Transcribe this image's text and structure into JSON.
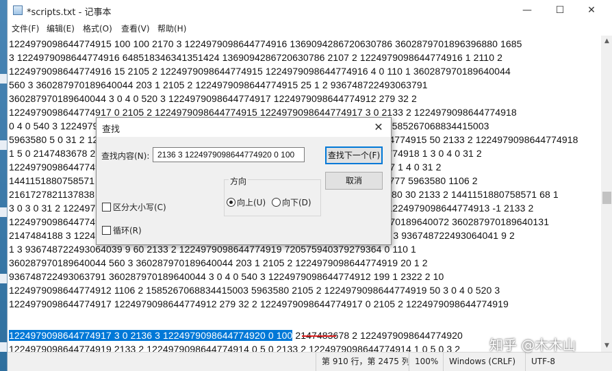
{
  "window": {
    "title": "*scripts.txt - 记事本",
    "minimize_glyph": "—",
    "maximize_glyph": "☐",
    "close_glyph": "✕"
  },
  "menu": [
    {
      "label": "文件(F)"
    },
    {
      "label": "编辑(E)"
    },
    {
      "label": "格式(O)"
    },
    {
      "label": "查看(V)"
    },
    {
      "label": "帮助(H)"
    }
  ],
  "content_lines": [
    "1224979098644774915 100 100 2170 3 1224979098644774916 1369094286720630786 3602879701896396880 1685",
    "3 1224979098644774916 648518346341351424 1369094286720630786 2107 2 1224979098644774916 1 2110 2",
    "1224979098644774916 15 2105 2 1224979098644774915 1224979098644774916 4 0 110 1 360287970189640044",
    "560 3 360287970189640044 203 1 2105 2 1224979098644774915 25 1 2 936748722493063791",
    "360287970189640044 3 0 4 0 520 3 1224979098644774917 1224979098644774912 279 32 2",
    "1224979098644774917 0 2105 2 1224979098644774915 1224979098644774917 3 0 2133 2 1224979098644774918",
    "0 4 0 540 3 1224979098644774917 3 0 2136 3 1224979098644774920 0 100 2 1106 2 1585267068834415003",
    "5963580 5 0 31 2 1224979098644774912 1106 2 1585267068834415003 224979098644774915 50 2133 2 1224979098644774918",
    "1 5 0 2147483678 2 1224979098644774920 2 1224979098644774912 1224979098644774918 1 3 0 4 0 31 2",
    "1224979098644774916 0 5 0 2133 2 1224979098644774914 1224979098644775857167 1 4 0 31 2",
    "1441151880758571 50 5 0 2136 3 1224979098644774920 0 100 2147483678 2 213785777 5963580 1106 2",
    "2161727821137838 2 1224979098644774915 1224979098644774916 3602879701899680 30 2133 2 1441151880758571 68 1",
    "3 0 3 0 31 2 1224979098644774917 1224979098644774912 1224979098644774931 2 1224979098644774913 -1 2133 2",
    "1224979098644774918 0 2136 3 1224979098644774920 0 100 2147483678 2 360287970189640072 360287970189640131",
    "2147484188 3 1224979098644774912 274 -1 360 3 1224979098644774912 274 4 4 0 1 3 936748722493064041 9 2",
    "1 3 936748722493064039 9 60 2133 2 1224979098644774919 720575940379279364 0 110 1",
    "360287970189640044 560 3 360287970189640044 203 1 2105 2 1224979098644774919 20 1 2",
    "936748722493063791 360287970189640044 3 0 4 0 540 3 1224979098644774912 199 1 2322 2 10",
    "1224979098644774912 1106 2 1585267068834415003 5963580 2105 2 1224979098644774919 50 3 0 4 0 520 3",
    "1224979098644774917 1224979098644774912 279 32 2 1224979098644774917 0 2105 2 1224979098644774919"
  ],
  "highlight_line": {
    "selected": "1224979098644774917 3 0 2136 3 1224979098644774920 0 100",
    "rest": " 2147483678 2 1224979098644774920"
  },
  "last_line": "1224979098644774919 2133 2 1224979098644774914 0 5 0 2133 2 1224979098644774914 1 0 5 0 3 2",
  "status": {
    "position": "第 910 行，第 2475 列",
    "zoom": "100%",
    "line_ending": "Windows (CRLF)",
    "encoding": "UTF-8"
  },
  "watermark": "知乎 @木木山",
  "find_dialog": {
    "title": "查找",
    "find_label": "查找内容(N):",
    "find_value": "2136 3 1224979098644774920 0 100",
    "find_next": "查找下一个(F)",
    "cancel": "取消",
    "direction_label": "方向",
    "up_label": "向上(U)",
    "down_label": "向下(D)",
    "direction_selected": "up",
    "match_case": "区分大小写(C)",
    "wrap": "循环(R)"
  },
  "icons": {
    "app": "notepad-icon",
    "close": "close-icon"
  }
}
